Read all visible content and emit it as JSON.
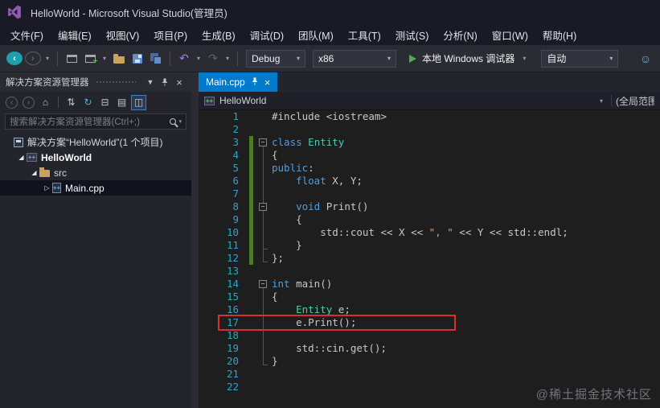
{
  "window": {
    "title": "HelloWorld - Microsoft Visual Studio(管理员)"
  },
  "menu": {
    "items": [
      "文件(F)",
      "编辑(E)",
      "视图(V)",
      "项目(P)",
      "生成(B)",
      "调试(D)",
      "团队(M)",
      "工具(T)",
      "测试(S)",
      "分析(N)",
      "窗口(W)",
      "帮助(H)"
    ]
  },
  "toolbar": {
    "config": "Debug",
    "platform": "x86",
    "run_label": "本地 Windows 调试器",
    "auto_label": "自动"
  },
  "solution_explorer": {
    "title": "解决方案资源管理器",
    "search_placeholder": "搜索解决方案资源管理器(Ctrl+;)",
    "toolbar_icons": [
      {
        "name": "navigate-back",
        "glyph": "back",
        "circle": true,
        "disabled": true
      },
      {
        "name": "navigate-forward",
        "glyph": "forward",
        "circle": true,
        "disabled": true
      },
      {
        "name": "home",
        "glyph": "home"
      },
      {
        "type": "sep"
      },
      {
        "name": "sync-with-active-document",
        "glyph": "sync"
      },
      {
        "name": "refresh",
        "glyph": "refresh",
        "accent": "#52b0c8"
      },
      {
        "name": "collapse-all",
        "glyph": "collapse_all"
      },
      {
        "name": "show-all-files",
        "glyph": "show_all"
      },
      {
        "name": "preview-selected-items",
        "glyph": "preview",
        "active": true
      }
    ],
    "tree": [
      {
        "name": "solution-node",
        "label": "解决方案“HelloWorld”(1 个项目)",
        "level": 0,
        "icon": "solution",
        "expander": "none"
      },
      {
        "name": "project-helloworld",
        "label": "HelloWorld",
        "level": 1,
        "icon": "cpp-project",
        "expander": "open",
        "bold": true
      },
      {
        "name": "folder-src",
        "label": "src",
        "level": 2,
        "icon": "folder",
        "expander": "open"
      },
      {
        "name": "file-main-cpp",
        "label": "Main.cpp",
        "level": 3,
        "icon": "cpp-file",
        "expander": "closed",
        "selected": true
      }
    ]
  },
  "editor": {
    "tab_label": "Main.cpp",
    "nav_left": "HelloWorld",
    "nav_right": "(全局范围)",
    "lines": [
      {
        "n": 1,
        "segs": [
          {
            "t": "#include <iostream>",
            "c": "txt"
          }
        ]
      },
      {
        "n": 2,
        "segs": []
      },
      {
        "n": 3,
        "fold": true,
        "segs": [
          {
            "t": "class",
            "c": "kw"
          },
          {
            "t": " ",
            "c": "txt"
          },
          {
            "t": "Entity",
            "c": "type"
          }
        ]
      },
      {
        "n": 4,
        "segs": [
          {
            "t": "{",
            "c": "txt"
          }
        ]
      },
      {
        "n": 5,
        "segs": [
          {
            "t": "public",
            "c": "kw"
          },
          {
            "t": ":",
            "c": "txt"
          }
        ]
      },
      {
        "n": 6,
        "segs": [
          {
            "t": "    ",
            "c": "txt"
          },
          {
            "t": "float",
            "c": "kw"
          },
          {
            "t": " X, Y;",
            "c": "txt"
          }
        ]
      },
      {
        "n": 7,
        "segs": []
      },
      {
        "n": 8,
        "fold": true,
        "segs": [
          {
            "t": "    ",
            "c": "txt"
          },
          {
            "t": "void",
            "c": "kw"
          },
          {
            "t": " Print()",
            "c": "txt"
          }
        ]
      },
      {
        "n": 9,
        "segs": [
          {
            "t": "    {",
            "c": "txt"
          }
        ]
      },
      {
        "n": 10,
        "segs": [
          {
            "t": "        std::cout << X << ",
            "c": "txt"
          },
          {
            "t": "\", \"",
            "c": "str"
          },
          {
            "t": " << Y << std::endl;",
            "c": "txt"
          }
        ]
      },
      {
        "n": 11,
        "segs": [
          {
            "t": "    }",
            "c": "txt"
          }
        ]
      },
      {
        "n": 12,
        "segs": [
          {
            "t": "};",
            "c": "txt"
          }
        ]
      },
      {
        "n": 13,
        "segs": []
      },
      {
        "n": 14,
        "fold": true,
        "segs": [
          {
            "t": "int",
            "c": "kw"
          },
          {
            "t": " main()",
            "c": "txt"
          }
        ]
      },
      {
        "n": 15,
        "segs": [
          {
            "t": "{",
            "c": "txt"
          }
        ]
      },
      {
        "n": 16,
        "segs": [
          {
            "t": "    ",
            "c": "txt"
          },
          {
            "t": "Entity",
            "c": "type"
          },
          {
            "t": " e;",
            "c": "txt"
          }
        ]
      },
      {
        "n": 17,
        "segs": [
          {
            "t": "    e.Print();",
            "c": "txt"
          }
        ]
      },
      {
        "n": 18,
        "segs": []
      },
      {
        "n": 19,
        "segs": [
          {
            "t": "    std::cin.get();",
            "c": "txt"
          }
        ]
      },
      {
        "n": 20,
        "segs": [
          {
            "t": "}",
            "c": "txt"
          }
        ]
      },
      {
        "n": 21,
        "segs": []
      },
      {
        "n": 22,
        "segs": []
      }
    ],
    "outlining": {
      "boxes": [
        3,
        8,
        14
      ],
      "guides": [
        {
          "from": 3,
          "to": 12
        },
        {
          "from": 8,
          "to": 11
        },
        {
          "from": 14,
          "to": 20
        }
      ]
    },
    "change_bars": [
      {
        "from": 3,
        "to": 12
      }
    ],
    "annotation": {
      "line": 17,
      "label": "red-highlight-box"
    }
  },
  "glyphs": {
    "caret": "▾",
    "window_position": "▼",
    "close": "×",
    "back": "‹",
    "forward": "›",
    "home": "⌂",
    "sync": "⇅",
    "refresh": "↻",
    "collapse_all": "⊟",
    "show_all": "▤",
    "preview": "◫",
    "undo": "↶",
    "redo": "↷",
    "expanded": "◢",
    "collapsed": "▷",
    "feedback": "☺",
    "minus": "−"
  },
  "colors": {
    "accent_tab": "#007acc",
    "keyword": "#569cd6",
    "type": "#4ec9b0",
    "string": "#d69d85",
    "text": "#c8c8c8",
    "line_number": "#35a2c8",
    "change_bar": "#4f7a28",
    "annotation": "#d63031",
    "run_green": "#4cae4f",
    "vs_purple": "#915bb5"
  },
  "watermark": "@稀土掘金技术社区"
}
